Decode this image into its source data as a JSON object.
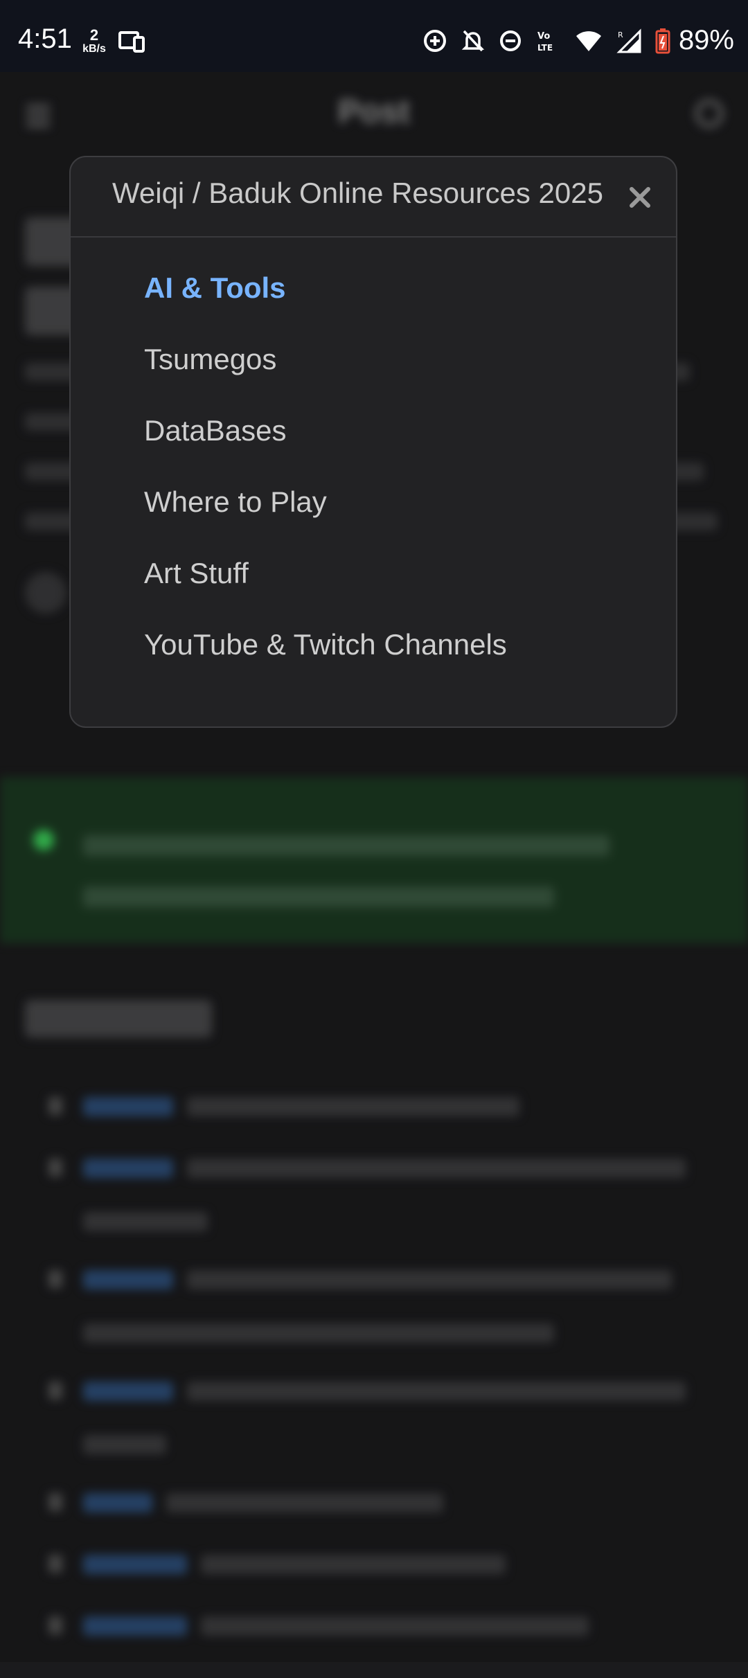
{
  "status_bar": {
    "time": "4:51",
    "data_rate_value": "2",
    "data_rate_unit": "kB/s",
    "battery": "89%",
    "icons": [
      "cast-icon",
      "data-saver-icon",
      "notifications-off-icon",
      "do-not-disturb-icon",
      "volte-icon",
      "wifi-icon",
      "signal-icon",
      "battery-icon"
    ]
  },
  "background": {
    "header_title": "Post"
  },
  "toc": {
    "title": "Weiqi / Baduk Online Resources 2025",
    "items": [
      {
        "label": "AI & Tools",
        "active": true
      },
      {
        "label": "Tsumegos",
        "active": false
      },
      {
        "label": "DataBases",
        "active": false
      },
      {
        "label": "Where to Play",
        "active": false
      },
      {
        "label": "Art Stuff",
        "active": false
      },
      {
        "label": "YouTube & Twitch Channels",
        "active": false
      }
    ]
  },
  "colors": {
    "accent": "#78b4ff",
    "modal_bg": "#222224",
    "page_bg": "#1b1b1d",
    "banner_bg": "#1c3a22"
  }
}
